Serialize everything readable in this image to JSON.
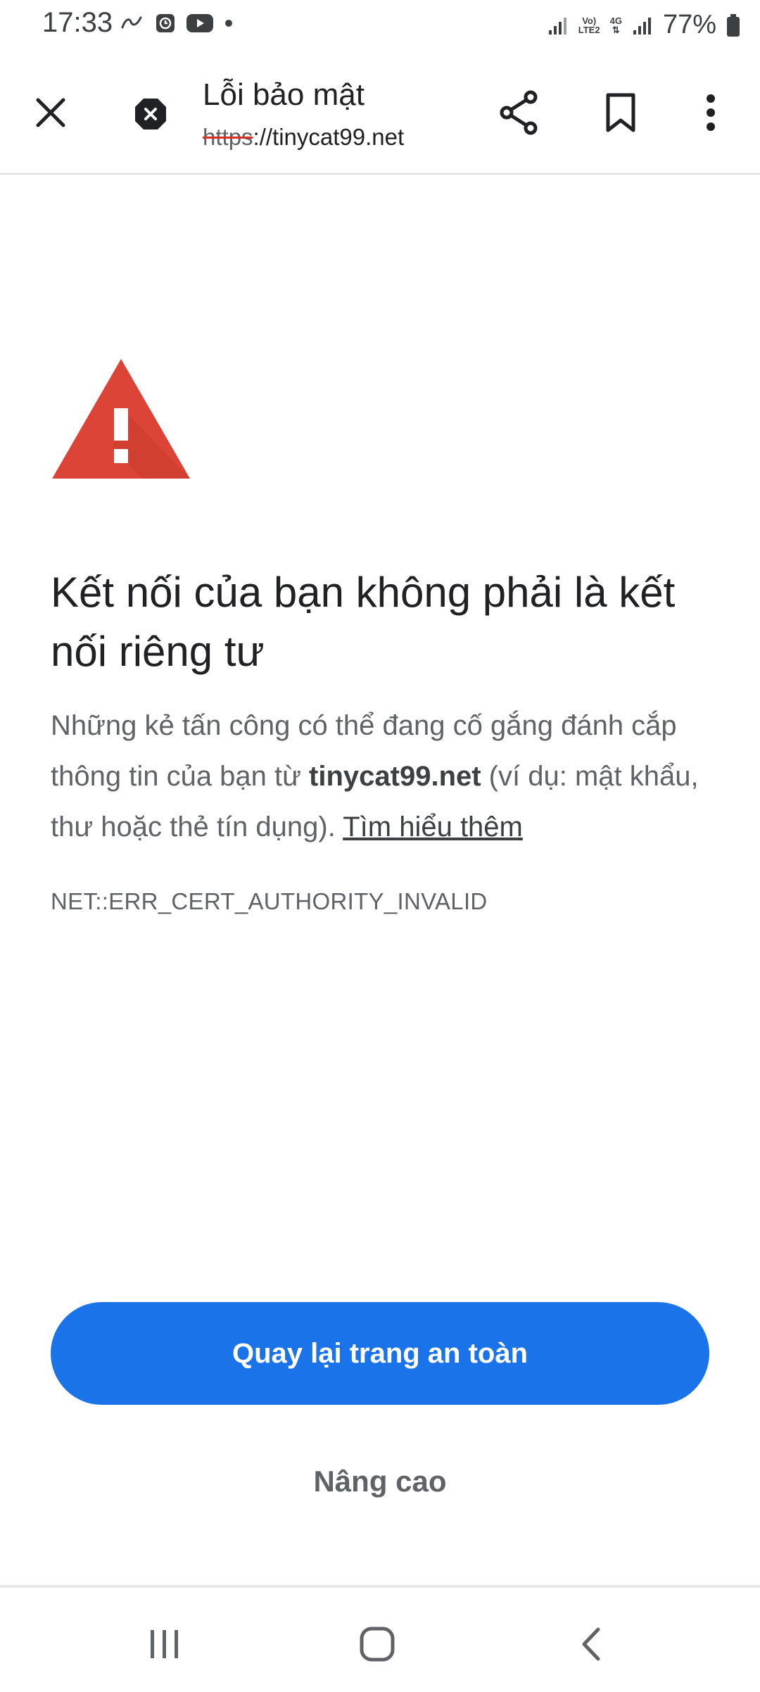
{
  "status_bar": {
    "time": "17:33",
    "volte_top": "Vo)",
    "volte_bottom": "LTE2",
    "network": "4G",
    "battery": "77%"
  },
  "toolbar": {
    "title": "Lỗi bảo mật",
    "url_scheme": "https",
    "url_rest": "://tinycat99.net"
  },
  "interstitial": {
    "headline": "Kết nối của bạn không phải là kết nối riêng tư",
    "text_before": "Những kẻ tấn công có thể đang cố gắng đánh cắp thông tin của bạn từ ",
    "host": "tinycat99.net",
    "text_after": " (ví dụ: mật khẩu, thư hoặc thẻ tín dụng). ",
    "learn_more": "Tìm hiểu thêm",
    "error_code": "NET::ERR_CERT_AUTHORITY_INVALID",
    "primary_button": "Quay lại trang an toàn",
    "secondary_button": "Nâng cao"
  },
  "icons": {
    "close": "close-icon",
    "security_error": "security-error-icon",
    "share": "share-icon",
    "bookmark": "bookmark-icon",
    "menu": "more-vert-icon",
    "warning": "warning-triangle-icon"
  },
  "colors": {
    "primary_button": "#1a73e8",
    "warning": "#db4437",
    "strike": "#d93025"
  }
}
